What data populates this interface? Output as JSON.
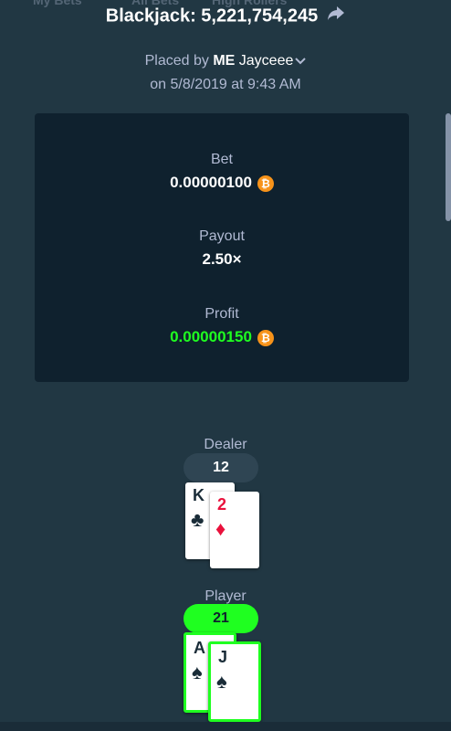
{
  "background_tabs": [
    "My Bets",
    "All Bets",
    "High Rollers"
  ],
  "title": "Blackjack: 5,221,754,245",
  "placed_by": {
    "prefix": "Placed by",
    "badge": "ME",
    "username": "Jayceee"
  },
  "date_line": "on 5/8/2019 at 9:43 AM",
  "stats": {
    "bet_label": "Bet",
    "bet_value": "0.00000100",
    "payout_label": "Payout",
    "payout_value": "2.50×",
    "profit_label": "Profit",
    "profit_value": "0.00000150",
    "currency_symbol": "₿"
  },
  "dealer": {
    "label": "Dealer",
    "score": "12",
    "cards": [
      {
        "rank": "K",
        "suit": "♣",
        "color": "black"
      },
      {
        "rank": "2",
        "suit": "♦",
        "color": "red"
      }
    ]
  },
  "player": {
    "label": "Player",
    "score": "21",
    "cards": [
      {
        "rank": "A",
        "suit": "♠",
        "color": "black"
      },
      {
        "rank": "J",
        "suit": "♠",
        "color": "black"
      }
    ]
  },
  "colors": {
    "background": "#213743",
    "panel": "#0f212e",
    "win_green": "#1fff20",
    "muted_text": "#b1bad3",
    "bitcoin_orange": "#f7931a",
    "card_red": "#e9113c"
  },
  "icons": [
    "share-icon",
    "chevron-down-icon",
    "bitcoin-icon"
  ]
}
